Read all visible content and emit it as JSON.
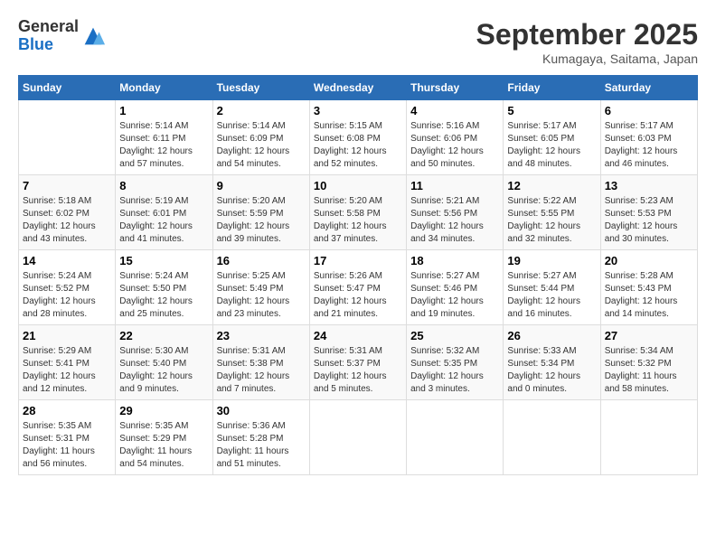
{
  "header": {
    "logo_line1": "General",
    "logo_line2": "Blue",
    "month": "September 2025",
    "location": "Kumagaya, Saitama, Japan"
  },
  "weekdays": [
    "Sunday",
    "Monday",
    "Tuesday",
    "Wednesday",
    "Thursday",
    "Friday",
    "Saturday"
  ],
  "weeks": [
    [
      {
        "date": "",
        "info": ""
      },
      {
        "date": "1",
        "info": "Sunrise: 5:14 AM\nSunset: 6:11 PM\nDaylight: 12 hours\nand 57 minutes."
      },
      {
        "date": "2",
        "info": "Sunrise: 5:14 AM\nSunset: 6:09 PM\nDaylight: 12 hours\nand 54 minutes."
      },
      {
        "date": "3",
        "info": "Sunrise: 5:15 AM\nSunset: 6:08 PM\nDaylight: 12 hours\nand 52 minutes."
      },
      {
        "date": "4",
        "info": "Sunrise: 5:16 AM\nSunset: 6:06 PM\nDaylight: 12 hours\nand 50 minutes."
      },
      {
        "date": "5",
        "info": "Sunrise: 5:17 AM\nSunset: 6:05 PM\nDaylight: 12 hours\nand 48 minutes."
      },
      {
        "date": "6",
        "info": "Sunrise: 5:17 AM\nSunset: 6:03 PM\nDaylight: 12 hours\nand 46 minutes."
      }
    ],
    [
      {
        "date": "7",
        "info": "Sunrise: 5:18 AM\nSunset: 6:02 PM\nDaylight: 12 hours\nand 43 minutes."
      },
      {
        "date": "8",
        "info": "Sunrise: 5:19 AM\nSunset: 6:01 PM\nDaylight: 12 hours\nand 41 minutes."
      },
      {
        "date": "9",
        "info": "Sunrise: 5:20 AM\nSunset: 5:59 PM\nDaylight: 12 hours\nand 39 minutes."
      },
      {
        "date": "10",
        "info": "Sunrise: 5:20 AM\nSunset: 5:58 PM\nDaylight: 12 hours\nand 37 minutes."
      },
      {
        "date": "11",
        "info": "Sunrise: 5:21 AM\nSunset: 5:56 PM\nDaylight: 12 hours\nand 34 minutes."
      },
      {
        "date": "12",
        "info": "Sunrise: 5:22 AM\nSunset: 5:55 PM\nDaylight: 12 hours\nand 32 minutes."
      },
      {
        "date": "13",
        "info": "Sunrise: 5:23 AM\nSunset: 5:53 PM\nDaylight: 12 hours\nand 30 minutes."
      }
    ],
    [
      {
        "date": "14",
        "info": "Sunrise: 5:24 AM\nSunset: 5:52 PM\nDaylight: 12 hours\nand 28 minutes."
      },
      {
        "date": "15",
        "info": "Sunrise: 5:24 AM\nSunset: 5:50 PM\nDaylight: 12 hours\nand 25 minutes."
      },
      {
        "date": "16",
        "info": "Sunrise: 5:25 AM\nSunset: 5:49 PM\nDaylight: 12 hours\nand 23 minutes."
      },
      {
        "date": "17",
        "info": "Sunrise: 5:26 AM\nSunset: 5:47 PM\nDaylight: 12 hours\nand 21 minutes."
      },
      {
        "date": "18",
        "info": "Sunrise: 5:27 AM\nSunset: 5:46 PM\nDaylight: 12 hours\nand 19 minutes."
      },
      {
        "date": "19",
        "info": "Sunrise: 5:27 AM\nSunset: 5:44 PM\nDaylight: 12 hours\nand 16 minutes."
      },
      {
        "date": "20",
        "info": "Sunrise: 5:28 AM\nSunset: 5:43 PM\nDaylight: 12 hours\nand 14 minutes."
      }
    ],
    [
      {
        "date": "21",
        "info": "Sunrise: 5:29 AM\nSunset: 5:41 PM\nDaylight: 12 hours\nand 12 minutes."
      },
      {
        "date": "22",
        "info": "Sunrise: 5:30 AM\nSunset: 5:40 PM\nDaylight: 12 hours\nand 9 minutes."
      },
      {
        "date": "23",
        "info": "Sunrise: 5:31 AM\nSunset: 5:38 PM\nDaylight: 12 hours\nand 7 minutes."
      },
      {
        "date": "24",
        "info": "Sunrise: 5:31 AM\nSunset: 5:37 PM\nDaylight: 12 hours\nand 5 minutes."
      },
      {
        "date": "25",
        "info": "Sunrise: 5:32 AM\nSunset: 5:35 PM\nDaylight: 12 hours\nand 3 minutes."
      },
      {
        "date": "26",
        "info": "Sunrise: 5:33 AM\nSunset: 5:34 PM\nDaylight: 12 hours\nand 0 minutes."
      },
      {
        "date": "27",
        "info": "Sunrise: 5:34 AM\nSunset: 5:32 PM\nDaylight: 11 hours\nand 58 minutes."
      }
    ],
    [
      {
        "date": "28",
        "info": "Sunrise: 5:35 AM\nSunset: 5:31 PM\nDaylight: 11 hours\nand 56 minutes."
      },
      {
        "date": "29",
        "info": "Sunrise: 5:35 AM\nSunset: 5:29 PM\nDaylight: 11 hours\nand 54 minutes."
      },
      {
        "date": "30",
        "info": "Sunrise: 5:36 AM\nSunset: 5:28 PM\nDaylight: 11 hours\nand 51 minutes."
      },
      {
        "date": "",
        "info": ""
      },
      {
        "date": "",
        "info": ""
      },
      {
        "date": "",
        "info": ""
      },
      {
        "date": "",
        "info": ""
      }
    ]
  ]
}
